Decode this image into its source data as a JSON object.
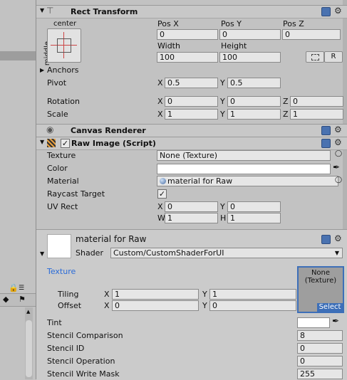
{
  "rect_transform": {
    "title": "Rect Transform",
    "anchor_preset_top": "center",
    "anchor_preset_side": "middle",
    "pos_x_label": "Pos X",
    "pos_y_label": "Pos Y",
    "pos_z_label": "Pos Z",
    "pos_x": "0",
    "pos_y": "0",
    "pos_z": "0",
    "width_label": "Width",
    "height_label": "Height",
    "width": "100",
    "height": "100",
    "r_button": "R",
    "anchors_label": "Anchors",
    "pivot_label": "Pivot",
    "pivot_x": "0.5",
    "pivot_y": "0.5",
    "rotation_label": "Rotation",
    "rotation_x": "0",
    "rotation_y": "0",
    "rotation_z": "0",
    "scale_label": "Scale",
    "scale_x": "1",
    "scale_y": "1",
    "scale_z": "1",
    "x": "X",
    "y": "Y",
    "z": "Z"
  },
  "canvas_renderer": {
    "title": "Canvas Renderer"
  },
  "raw_image": {
    "title": "Raw Image (Script)",
    "texture_label": "Texture",
    "texture_value": "None (Texture)",
    "color_label": "Color",
    "color_value": "#ffffff",
    "material_label": "Material",
    "material_value": "material for Raw",
    "raycast_label": "Raycast Target",
    "raycast_checked": true,
    "uvrect_label": "UV Rect",
    "uv_x": "0",
    "uv_y": "0",
    "uv_w": "1",
    "uv_h": "1",
    "w": "W",
    "h": "H"
  },
  "material": {
    "name": "material for Raw",
    "shader_label": "Shader",
    "shader_value": "Custom/CustomShaderForUI",
    "texture_prop": "Texture",
    "tiling_label": "Tiling",
    "tiling_x": "1",
    "tiling_y": "1",
    "offset_label": "Offset",
    "offset_x": "0",
    "offset_y": "0",
    "slot_none": "None",
    "slot_type": "(Texture)",
    "slot_select": "Select",
    "tint_label": "Tint",
    "stencil_comparison_label": "Stencil Comparison",
    "stencil_comparison": "8",
    "stencil_id_label": "Stencil ID",
    "stencil_id": "0",
    "stencil_operation_label": "Stencil Operation",
    "stencil_operation": "0",
    "stencil_write_label": "Stencil Write Mask",
    "stencil_write": "255"
  },
  "colors": {
    "header": "#c8c8c8",
    "panel": "#c2c2c2",
    "accent_blue": "#2a6bd8",
    "select_bg": "#3d6fb8"
  }
}
